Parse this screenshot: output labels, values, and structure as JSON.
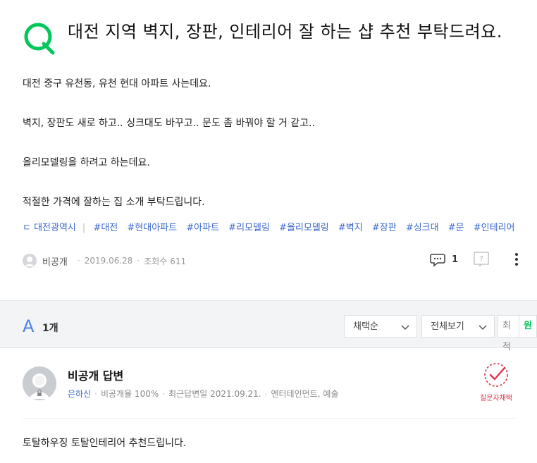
{
  "question": {
    "title": "대전 지역 벽지, 장판, 인테리어 잘 하는 샵 추천 부탁드려요.",
    "body": [
      "대전 중구 유천동, 유천 현대 아파트 사는데요.",
      "벽지, 장판도 새로 하고.. 싱크대도 바꾸고.. 문도 좀 바꿔야 할 거 같고..",
      "올리모델링을 하려고 하는데요.",
      "적절한 가격에 잘하는 집 소개 부탁드립니다."
    ],
    "tags": [
      "ㄷ 대전광역시",
      "#대전",
      "#현대아파트",
      "#아파트",
      "#리모델링",
      "#올리모델링",
      "#벽지",
      "#장판",
      "#싱크대",
      "#문",
      "#인테리어"
    ],
    "author": "비공개",
    "date": "2019.06.28",
    "views": "조회수 611",
    "comment_count": "1"
  },
  "answers_bar": {
    "letter": "A",
    "count": "1개",
    "sort_select": "채택순",
    "filter_select": "전체보기",
    "seg_recent": "최적",
    "seg_active": "원"
  },
  "answer": {
    "title": "비공개 답변",
    "nickname": "은하신",
    "private_rate": "비공개율 100%",
    "last_answer": "최근답변일 2021.09.21.",
    "category": "엔터테인먼트, 예술",
    "adopt_label": "질문자채택",
    "body": "토탈하우징 토탈인테리어 추천드립니다."
  },
  "colors": {
    "accent_green": "#03c75a",
    "link_blue": "#3c6acd",
    "adopt_red": "#e0334a"
  }
}
